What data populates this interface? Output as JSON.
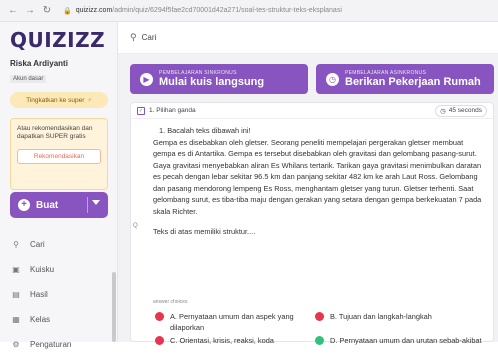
{
  "browser": {
    "url_host": "quizizz.com",
    "url_path": "/admin/quiz/6294f5fae2cd70001d42a271/soal-tes-struktur-teks-eksplanasi"
  },
  "sidebar": {
    "logo": "QUIZIZZ",
    "user_name": "Riska Ardiyanti",
    "account_type": "Akun dasar",
    "upgrade_label": "Tingkatkan ke super",
    "promo_text": "Atau rekomendasikan dan dapatkan SUPER gratis",
    "promo_button": "Rekomendasikan",
    "create_button": "Buat",
    "nav_items": [
      {
        "label": "Cari",
        "icon": "search-icon"
      },
      {
        "label": "Kuisku",
        "icon": "folder-icon"
      },
      {
        "label": "Hasil",
        "icon": "chart-icon"
      },
      {
        "label": "Kelas",
        "icon": "class-icon"
      },
      {
        "label": "Pengaturan",
        "icon": "gear-icon"
      }
    ]
  },
  "search": {
    "value": "Cari"
  },
  "main": {
    "sync_button": {
      "sub": "PEMBELAJARAN SINKRONUS",
      "label": "Mulai kuis langsung"
    },
    "async_button": {
      "sub": "PEMBELAJARAN ASINKRONUS",
      "label": "Berikan Pekerjaan Rumah"
    },
    "question": {
      "type_label": "1. Pilihan ganda",
      "time_label": "45 seconds",
      "marker": "Q",
      "intro": "1.   Bacalah teks dibawah ini!",
      "passage": "Gempa es disebabkan oleh gletser. Seorang peneliti mempelajari pergerakan gletser membuat gempa es di Antartika. Gempa es tersebut disebabkan oleh gravitasi dan gelombang pasang-surut. Gaya gravitasi menyebabkan aliran Es Whilans tertarik. Tarikan gaya gravitasi menimbulkan daratan es pecah dengan lebar sekitar 96.5 km dan panjang sekitar 482 km ke arah Laut Ross. Gelombang dan pasang mendorong lempeng Es Ross, menghantam gletser yang turun. Gletser terhenti. Saat gelombang surut, es tiba-tiba maju dengan gerakan yang setara dengan gempa berkekuatan 7 pada skala Richter.",
      "prompt": "Teks di atas memiliki struktur....",
      "answer_label": "answer choices",
      "options": [
        {
          "text": "A. Pernyataan umum dan aspek yang dilaporkan",
          "color": "#e8344d"
        },
        {
          "text": "B. Tujuan dan langkah-langkah",
          "color": "#e8344d"
        },
        {
          "text": "C. Orientasi, krisis, reaksi, koda",
          "color": "#e8344d"
        },
        {
          "text": "D. Pernyataan umum dan urutan sebab-akibat",
          "color": "#2ec27e"
        }
      ]
    }
  },
  "colors": {
    "brand_purple": "#8854c0",
    "incorrect": "#e8344d",
    "correct": "#2ec27e"
  }
}
